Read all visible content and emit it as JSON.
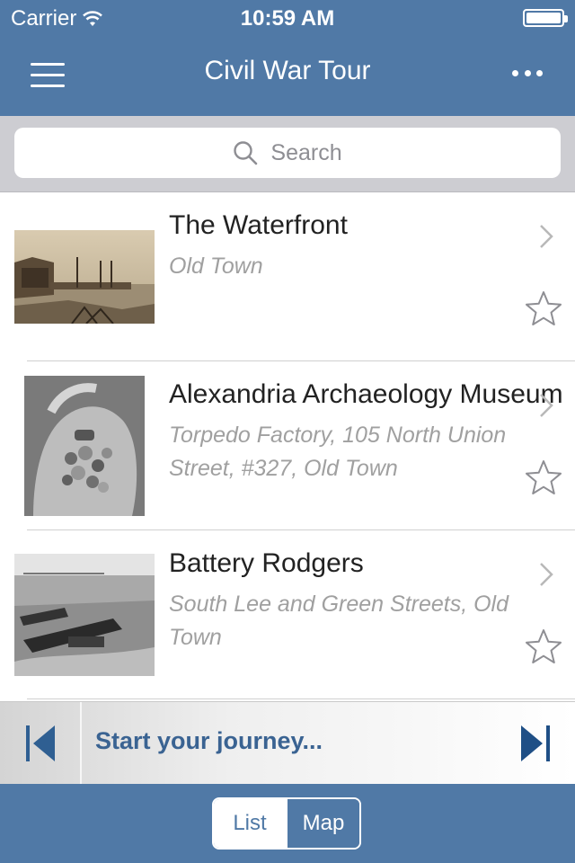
{
  "status_bar": {
    "carrier": "Carrier",
    "time": "10:59 AM"
  },
  "nav": {
    "title": "Civil War Tour",
    "menu_icon": "hamburger-icon",
    "more_icon": "ellipsis-icon"
  },
  "search": {
    "placeholder": "Search",
    "icon": "search-icon"
  },
  "tours": [
    {
      "title": "The Waterfront",
      "location": "Old Town"
    },
    {
      "title": "Alexandria Archaeology Museum",
      "location": "Torpedo Factory, 105 North Union Street, #327, Old Town"
    },
    {
      "title": "Battery Rodgers",
      "location": "South Lee and Green Streets, Old Town"
    }
  ],
  "player": {
    "label": "Start your journey...",
    "prev_icon": "skip-previous-icon",
    "next_icon": "skip-next-icon"
  },
  "tabs": {
    "list_label": "List",
    "map_label": "Map",
    "selected": "List"
  },
  "colors": {
    "nav_blue": "#5079a6",
    "accent_text": "#3a6392"
  }
}
